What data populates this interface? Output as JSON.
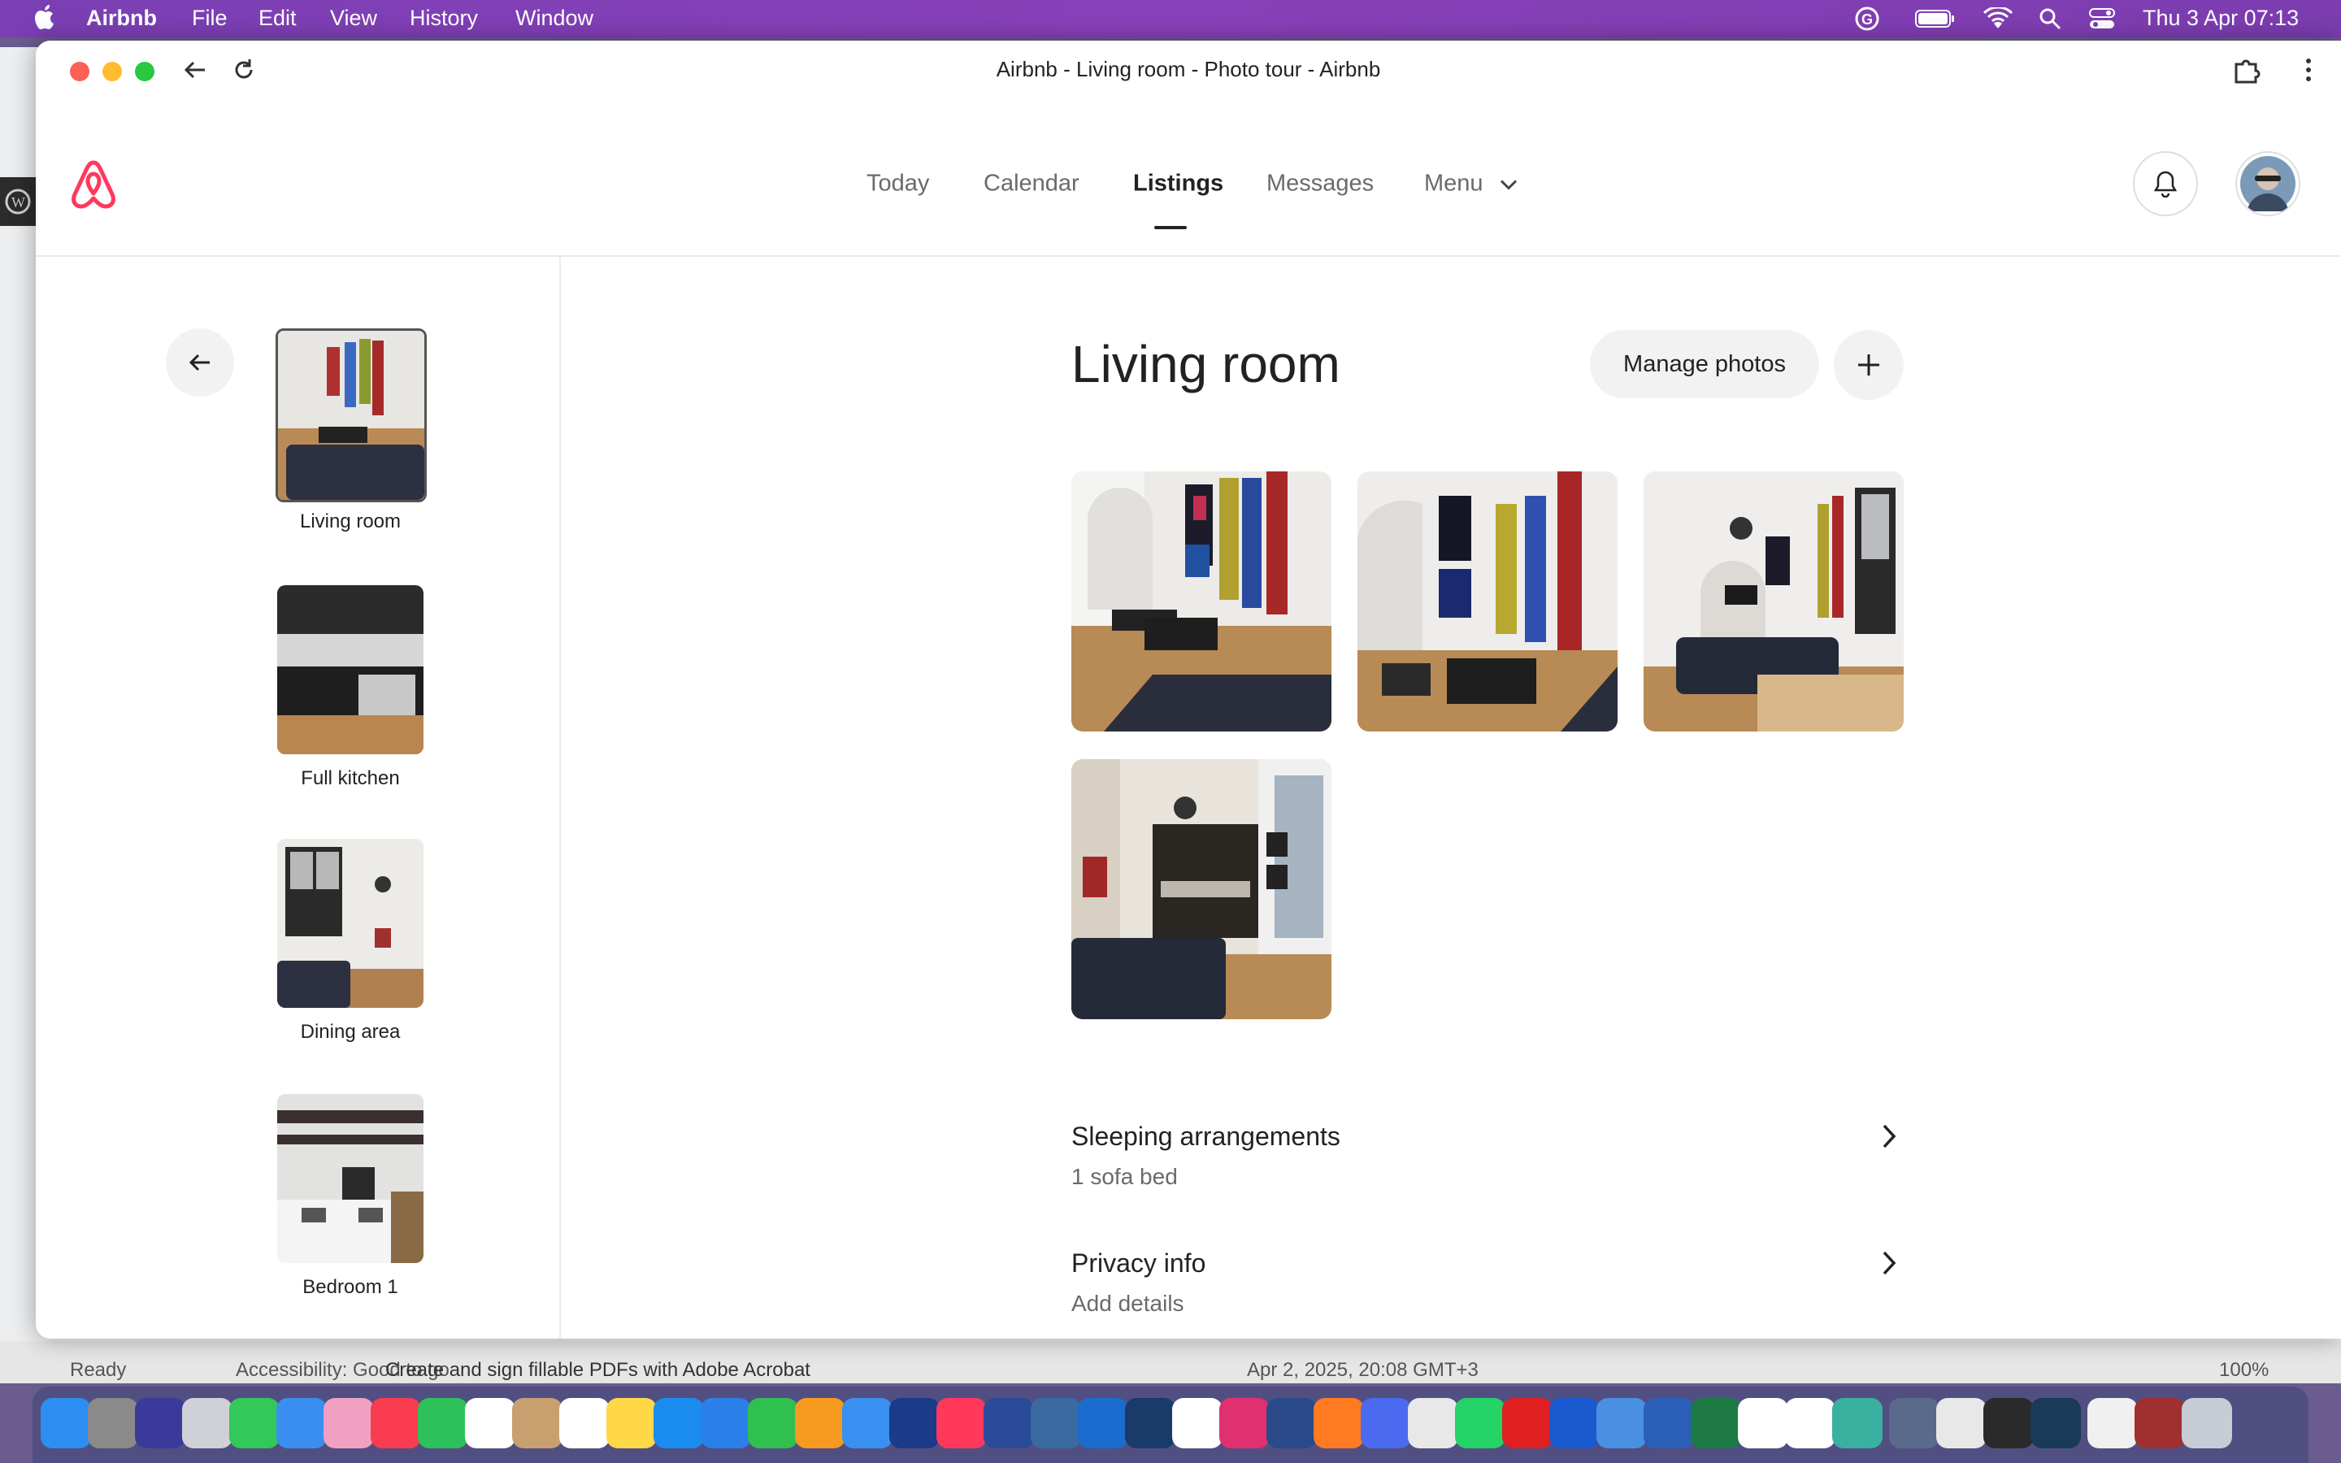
{
  "menubar": {
    "app_name": "Airbnb",
    "menus": [
      "File",
      "Edit",
      "View",
      "History",
      "Window"
    ],
    "clock": "Thu 3 Apr  07:13"
  },
  "background_window": {
    "status_left": "Ready",
    "status_accessibility": "Accessibility: Good to go",
    "status_tip": "Create and sign fillable PDFs with Adobe Acrobat",
    "status_date": "Apr 2, 2025, 20:08 GMT+3",
    "zoom": "100%"
  },
  "window": {
    "title": "Airbnb - Living room - Photo tour - Airbnb"
  },
  "nav": {
    "links": [
      "Today",
      "Calendar",
      "Listings",
      "Messages",
      "Menu"
    ],
    "active": "Listings"
  },
  "sidebar": {
    "rooms": [
      {
        "label": "Living room",
        "active": true
      },
      {
        "label": "Full kitchen",
        "active": false
      },
      {
        "label": "Dining area",
        "active": false
      },
      {
        "label": "Bedroom 1",
        "active": false
      }
    ]
  },
  "main": {
    "title": "Living room",
    "manage_label": "Manage photos",
    "sections": [
      {
        "title": "Sleeping arrangements",
        "subtitle": "1 sofa bed"
      },
      {
        "title": "Privacy info",
        "subtitle": "Add details"
      }
    ]
  },
  "colors": {
    "brand": "#ff385c",
    "text": "#222222",
    "muted": "#6a6a6a"
  }
}
